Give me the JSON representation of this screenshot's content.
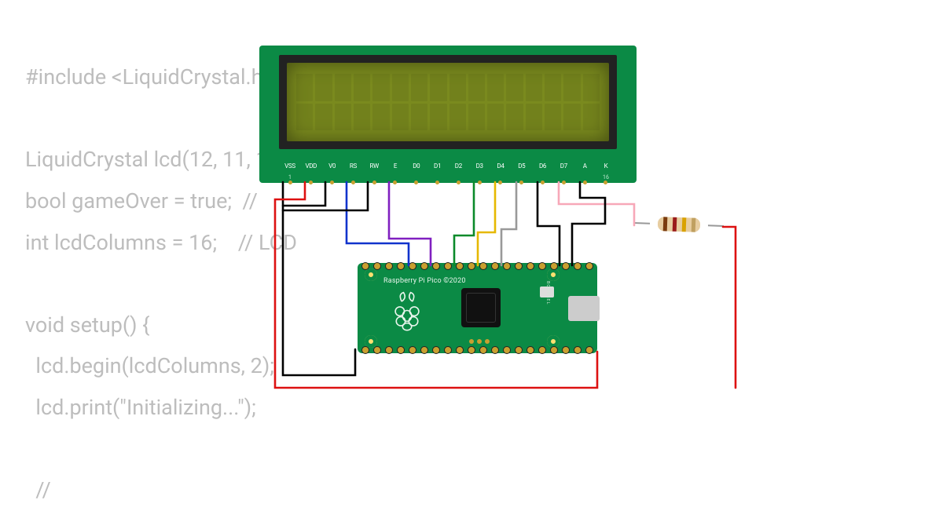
{
  "code": {
    "line1": "#include <LiquidCrystal.h",
    "line2": "",
    "line3": "LiquidCrystal lcd(12, 11, 1",
    "line4": "bool gameOver = true;  //",
    "line5": "int lcdColumns = 16;    // LCD",
    "line6": "",
    "line7": "void setup() {",
    "line8": "  lcd.begin(lcdColumns, 2);",
    "line9": "  lcd.print(\"Initializing...\");",
    "line10": "",
    "line11": "  //"
  },
  "lcd": {
    "pins": [
      "VSS",
      "VDD",
      "V0",
      "RS",
      "RW",
      "E",
      "D0",
      "D1",
      "D2",
      "D3",
      "D4",
      "D5",
      "D6",
      "D7",
      "A",
      "K"
    ],
    "pin_nums": [
      "1",
      "",
      "",
      "",
      "",
      "",
      "",
      "",
      "",
      "",
      "",
      "",
      "",
      "",
      "",
      "16"
    ],
    "cols": 16,
    "rows": 2
  },
  "pico": {
    "label": "Raspberry Pi Pico ©2020",
    "bootsel": "BOOTSEL"
  },
  "resistor": {
    "bands": [
      "brown",
      "red",
      "gold",
      "tan"
    ]
  },
  "wires": [
    {
      "name": "vss-gnd",
      "color": "#000"
    },
    {
      "name": "vdd-5v",
      "color": "#d11"
    },
    {
      "name": "v0-gnd",
      "color": "#000"
    },
    {
      "name": "rs-gp12",
      "color": "#1133cc"
    },
    {
      "name": "rw-gnd",
      "color": "#000"
    },
    {
      "name": "e-gp11",
      "color": "#8020c0"
    },
    {
      "name": "d4-gp10",
      "color": "#0a8a2a"
    },
    {
      "name": "d5-gp9",
      "color": "#e6b800"
    },
    {
      "name": "d6-gp8",
      "color": "#999"
    },
    {
      "name": "d7-gp7",
      "color": "#000"
    },
    {
      "name": "a-resistor",
      "color": "#ffb6c1"
    },
    {
      "name": "k-gnd",
      "color": "#000"
    },
    {
      "name": "resistor-5v",
      "color": "#d11"
    }
  ]
}
